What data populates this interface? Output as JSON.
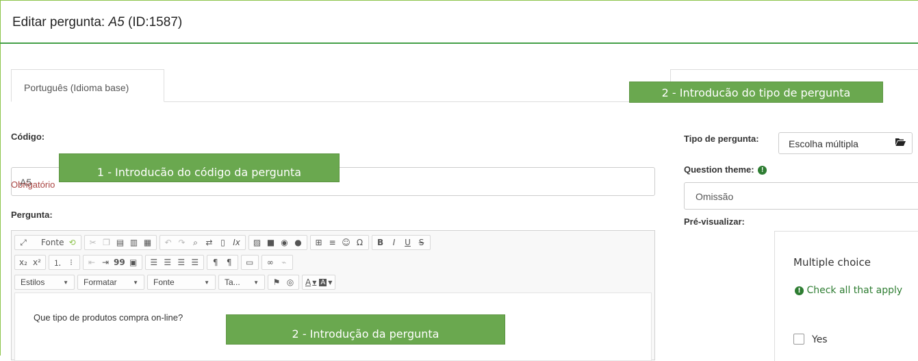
{
  "header": {
    "title_prefix": "Editar pergunta: ",
    "question_code": "A5",
    "id_text": " (ID:1587)"
  },
  "tabs": [
    {
      "label": "Português (Idioma base)"
    }
  ],
  "callouts": {
    "code": "1 - Introducão do código da pergunta",
    "type": "2 - Introducão do tipo de pergunta",
    "question": "2 - Introdução da pergunta"
  },
  "form": {
    "code_label": "Código:",
    "code_value": "A5",
    "required_text": "Obrigatório",
    "question_label": "Pergunta:"
  },
  "editor": {
    "row1": {
      "source_label": "Fonte",
      "bold": "B",
      "italic": "I",
      "underline": "U",
      "strike": "S",
      "omega": "Ω"
    },
    "row2": {
      "subscript": "x₂",
      "superscript": "x²",
      "quote": "99"
    },
    "row3": {
      "styles": "Estilos",
      "format": "Formatar",
      "font": "Fonte",
      "size": "Ta...",
      "text_color": "A",
      "bg_color": "A"
    },
    "content": "Que tipo de produtos compra on-line?"
  },
  "right_panel": {
    "type_label": "Tipo de pergunta:",
    "type_value": "Escolha múltipla",
    "theme_label": "Question theme:",
    "theme_value": "Omissão",
    "preview_label": "Pré-visualizar:",
    "preview": {
      "question": "Multiple choice",
      "hint": "Check all that apply",
      "option": "Yes"
    }
  },
  "colors": {
    "accent_green": "#43a047",
    "callout_green": "#6aa84f",
    "error_red": "#a94442"
  }
}
